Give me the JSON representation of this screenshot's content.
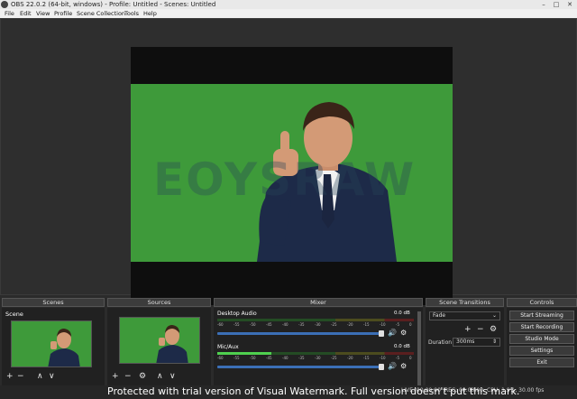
{
  "window": {
    "title": "OBS 22.0.2 (64-bit, windows) - Profile: Untitled - Scenes: Untitled",
    "minimize": "–",
    "maximize": "□",
    "close": "✕"
  },
  "menu": [
    "File",
    "Edit",
    "View",
    "Profile",
    "Scene Collection",
    "Tools",
    "Help"
  ],
  "preview": {
    "watermark_logo": "EOYSRAW"
  },
  "scenes": {
    "header": "Scenes",
    "items": [
      {
        "label": "Scene"
      }
    ],
    "tools": {
      "add": "+",
      "remove": "−",
      "up": "∧",
      "down": "∨"
    }
  },
  "sources": {
    "header": "Sources",
    "tools": {
      "add": "+",
      "remove": "−",
      "settings": "⚙",
      "up": "∧",
      "down": "∨"
    }
  },
  "mixer": {
    "header": "Mixer",
    "channels": [
      {
        "name": "Desktop Audio",
        "db": "0.0 dB",
        "volume": 1.0
      },
      {
        "name": "Mic/Aux",
        "db": "0.0 dB",
        "volume": 1.0
      }
    ],
    "scale": [
      "-60",
      "-55",
      "-50",
      "-45",
      "-40",
      "-35",
      "-30",
      "-25",
      "-20",
      "-15",
      "-10",
      "-5",
      "0"
    ],
    "speaker_icon": "🔊",
    "settings_icon": "⚙"
  },
  "transitions": {
    "header": "Scene Transitions",
    "selected": "Fade",
    "add": "+",
    "remove": "−",
    "settings": "⚙",
    "duration_label": "Duration",
    "duration_value": "300ms"
  },
  "controls": {
    "header": "Controls",
    "buttons": [
      "Start Streaming",
      "Start Recording",
      "Studio Mode",
      "Settings",
      "Exit"
    ]
  },
  "status": {
    "live": "LIVE: 00:00:00",
    "rec": "REC: 00:00:00",
    "cpu": "CPU: 1.9%, 30.00 fps"
  },
  "overlay": {
    "notice": "Protected with trial version of Visual Watermark. Full version doesn't put this mark."
  }
}
